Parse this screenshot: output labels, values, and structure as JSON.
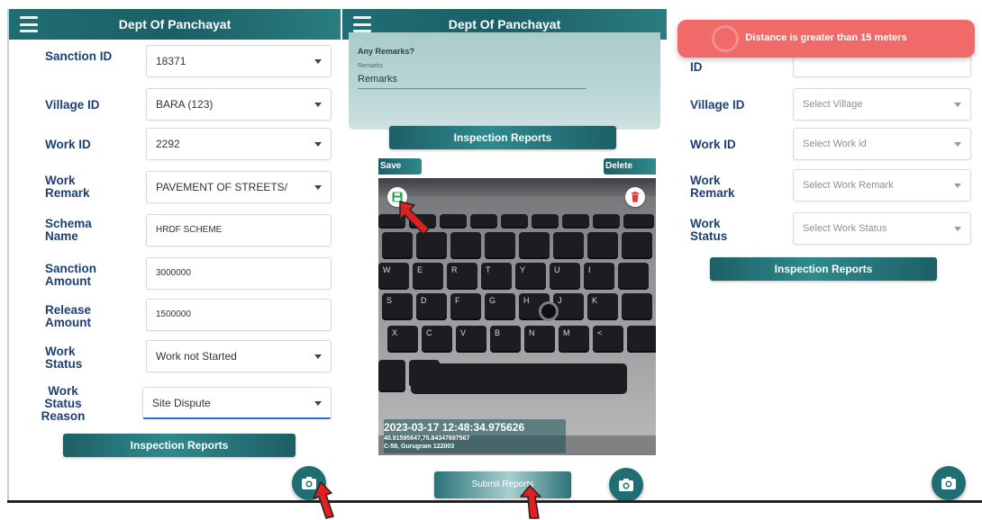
{
  "app": {
    "title": "Dept Of Panchayat"
  },
  "panel1": {
    "fields": [
      {
        "label": "Sanction ID",
        "value": "18371",
        "type": "select"
      },
      {
        "label": "Village ID",
        "value": "BARA (123)",
        "type": "select"
      },
      {
        "label": "Work ID",
        "value": "2292",
        "type": "select"
      },
      {
        "label": "Work Remark",
        "value": "PAVEMENT OF STREETS/",
        "type": "select"
      },
      {
        "label": "Schema Name",
        "value": "HRDF SCHEME",
        "type": "text"
      },
      {
        "label": "Sanction Amount",
        "value": "3000000",
        "type": "text"
      },
      {
        "label": "Release Amount",
        "value": "1500000",
        "type": "text"
      },
      {
        "label": "Work Status",
        "value": "Work not Started",
        "type": "select"
      },
      {
        "label": "Work Status Reason",
        "value": "Site Dispute",
        "type": "select"
      }
    ],
    "inspection_button": "Inspection Reports"
  },
  "panel2": {
    "remarks_question": "Any Remarks?",
    "remarks_label": "Remarks",
    "remarks_value": "Remarks",
    "inspection_button": "Inspection Reports",
    "save_label": "Save",
    "delete_label": "Delete",
    "photo_stamp": {
      "timestamp": "2023-03-17 12:48:34.975626",
      "coords": "40.91595647,75.84347697567",
      "address": "C-58, Gurugram 122003"
    },
    "keys_row1": [
      "W",
      "E",
      "R",
      "T",
      "Y",
      "U",
      "I"
    ],
    "keys_row2": [
      "S",
      "D",
      "F",
      "G",
      "H",
      "J",
      "K"
    ],
    "keys_row3": [
      "X",
      "C",
      "V",
      "B",
      "N",
      "M",
      "<"
    ],
    "submit_button": "Submit Reports"
  },
  "panel3": {
    "toast_message": "Distance is greater than 15 meters",
    "fields": [
      {
        "label": "ID",
        "placeholder": ""
      },
      {
        "label": "Village ID",
        "placeholder": "Select Village"
      },
      {
        "label": "Work ID",
        "placeholder": "Select Work id"
      },
      {
        "label": "Work Remark",
        "placeholder": "Select Work Remark"
      },
      {
        "label": "Work Status",
        "placeholder": "Select Work Status"
      }
    ],
    "inspection_button": "Inspection Reports"
  },
  "colors": {
    "accent": "#1f6e73",
    "label": "#1f3f73",
    "toast": "#f06a6a",
    "arrow": "#e02020"
  },
  "icons": {
    "menu": "hamburger-icon",
    "camera": "camera-icon",
    "save": "floppy-disk-icon",
    "delete": "trash-icon"
  }
}
